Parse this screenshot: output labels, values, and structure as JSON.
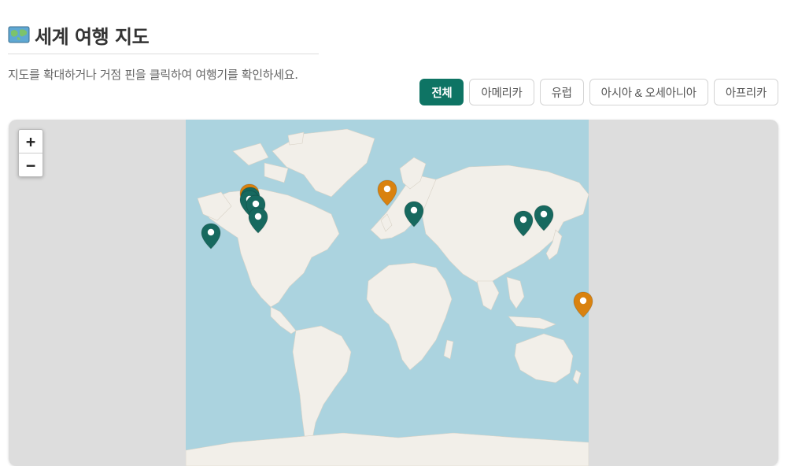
{
  "header": {
    "emoji_icon": "world-map-icon",
    "title": "세계 여행 지도",
    "subtitle": "지도를 확대하거나 거점 핀을 클릭하여 여행기를 확인하세요."
  },
  "filters": [
    {
      "label": "전체",
      "active": true
    },
    {
      "label": "아메리카",
      "active": false
    },
    {
      "label": "유럽",
      "active": false
    },
    {
      "label": "아시아 & 오세아니아",
      "active": false
    },
    {
      "label": "아프리카",
      "active": false
    }
  ],
  "map": {
    "zoom_in_label": "+",
    "zoom_out_label": "−",
    "colors": {
      "ocean": "#abd3df",
      "land": "#f2efe9",
      "pin_teal": "#17695f",
      "pin_orange": "#d9820f",
      "accent": "#0e7464"
    },
    "pins": [
      {
        "name": "pin-hawaii",
        "color": "teal",
        "lon": -157.8,
        "lat": 21.3
      },
      {
        "name": "pin-vancouver",
        "color": "orange",
        "lon": -123.1,
        "lat": 49.3
      },
      {
        "name": "pin-seattle",
        "color": "teal",
        "lon": -122.3,
        "lat": 47.6
      },
      {
        "name": "pin-portland",
        "color": "teal",
        "lon": -122.7,
        "lat": 45.5
      },
      {
        "name": "pin-san-francisco",
        "color": "teal",
        "lon": -117.4,
        "lat": 42.3
      },
      {
        "name": "pin-los-angeles",
        "color": "teal",
        "lon": -115.0,
        "lat": 33.5
      },
      {
        "name": "pin-london",
        "color": "orange",
        "lon": 0.0,
        "lat": 51.5
      },
      {
        "name": "pin-athens",
        "color": "teal",
        "lon": 23.7,
        "lat": 38.0
      },
      {
        "name": "pin-shanghai",
        "color": "teal",
        "lon": 121.5,
        "lat": 31.2
      },
      {
        "name": "pin-tokyo",
        "color": "teal",
        "lon": 139.7,
        "lat": 35.7
      },
      {
        "name": "pin-new-zealand",
        "color": "orange",
        "lon": 174.8,
        "lat": -36.8
      }
    ]
  }
}
